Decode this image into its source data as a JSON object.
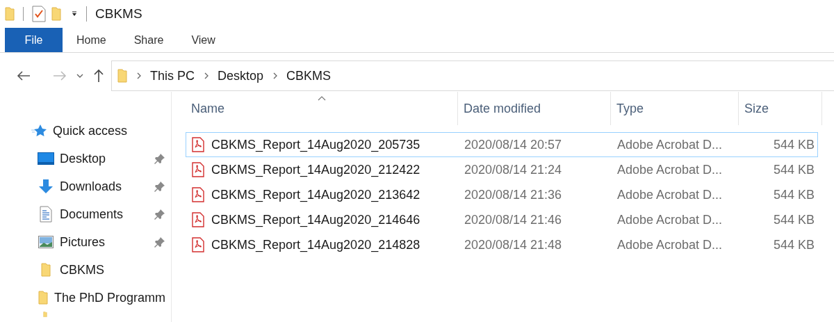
{
  "window": {
    "title": "CBKMS"
  },
  "ribbon_tabs": [
    {
      "label": "File",
      "selected": true
    },
    {
      "label": "Home",
      "selected": false
    },
    {
      "label": "Share",
      "selected": false
    },
    {
      "label": "View",
      "selected": false
    }
  ],
  "breadcrumb": [
    "This PC",
    "Desktop",
    "CBKMS"
  ],
  "sidebar": {
    "items": [
      {
        "label": "Quick access",
        "kind": "quick",
        "pinned": false
      },
      {
        "label": "Desktop",
        "kind": "desktop",
        "pinned": true
      },
      {
        "label": "Downloads",
        "kind": "downloads",
        "pinned": true
      },
      {
        "label": "Documents",
        "kind": "documents",
        "pinned": true
      },
      {
        "label": "Pictures",
        "kind": "pictures",
        "pinned": true
      },
      {
        "label": "CBKMS",
        "kind": "folder",
        "pinned": false
      },
      {
        "label": "The PhD Programm",
        "kind": "folder",
        "pinned": false
      }
    ]
  },
  "table": {
    "columns": [
      "Name",
      "Date modified",
      "Type",
      "Size"
    ],
    "rows": [
      {
        "name": "CBKMS_Report_14Aug2020_205735",
        "date": "2020/08/14 20:57",
        "type": "Adobe Acrobat D...",
        "size": "544 KB",
        "focused": true
      },
      {
        "name": "CBKMS_Report_14Aug2020_212422",
        "date": "2020/08/14 21:24",
        "type": "Adobe Acrobat D...",
        "size": "544 KB",
        "focused": false
      },
      {
        "name": "CBKMS_Report_14Aug2020_213642",
        "date": "2020/08/14 21:36",
        "type": "Adobe Acrobat D...",
        "size": "544 KB",
        "focused": false
      },
      {
        "name": "CBKMS_Report_14Aug2020_214646",
        "date": "2020/08/14 21:46",
        "type": "Adobe Acrobat D...",
        "size": "544 KB",
        "focused": false
      },
      {
        "name": "CBKMS_Report_14Aug2020_214828",
        "date": "2020/08/14 21:48",
        "type": "Adobe Acrobat D...",
        "size": "544 KB",
        "focused": false
      }
    ]
  }
}
